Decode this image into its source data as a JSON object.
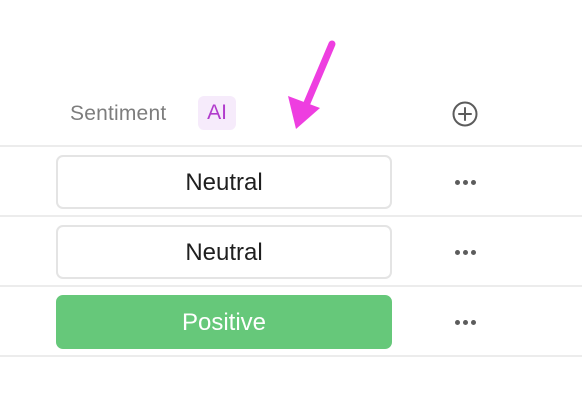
{
  "header": {
    "column_title": "Sentiment",
    "ai_badge": "AI",
    "add_column_icon": "plus-circle-icon"
  },
  "rows": [
    {
      "value": "Neutral",
      "status": "neutral",
      "more_icon": "ellipsis-icon"
    },
    {
      "value": "Neutral",
      "status": "neutral",
      "more_icon": "ellipsis-icon"
    },
    {
      "value": "Positive",
      "status": "positive",
      "more_icon": "ellipsis-icon"
    }
  ],
  "annotation": {
    "arrow_icon": "pointer-arrow-icon",
    "arrow_color": "#ee3ee0"
  },
  "colors": {
    "ai_badge_bg": "#f6ebfb",
    "ai_badge_text": "#b13ccc",
    "positive": "#66c87a",
    "neutral_border": "#e4e4e4"
  }
}
